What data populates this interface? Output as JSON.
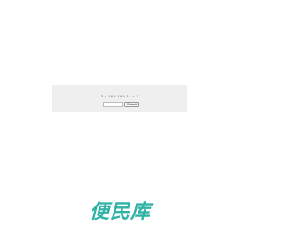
{
  "captcha": {
    "question": "3 + 16 * 18 * 14 = ?",
    "answer_value": "",
    "submit_label": "Submit"
  },
  "brand": {
    "logo_text": "便民库",
    "color": "#2fb3a6"
  },
  "colors": {
    "background": "#ffffff",
    "captcha_panel": "#efefef"
  }
}
